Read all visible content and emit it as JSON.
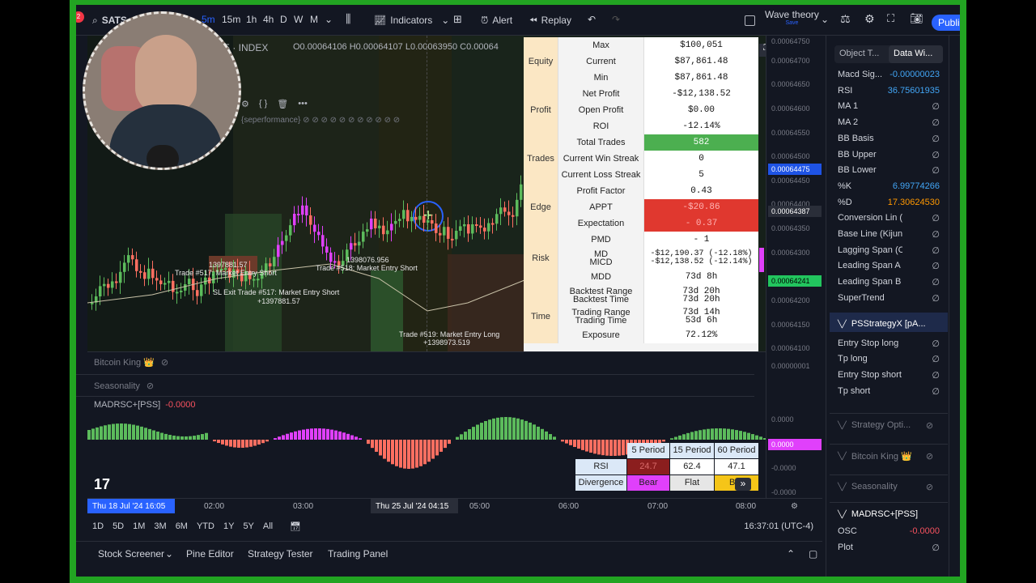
{
  "toolbar": {
    "symbol": "SATS",
    "timeframes": [
      "5m",
      "15m",
      "1h",
      "4h",
      "D",
      "W",
      "M"
    ],
    "indicators_label": "Indicators",
    "alert_label": "Alert",
    "replay_label": "Replay",
    "layout_name": "Wave theory",
    "layout_status": "Save",
    "publish_label": "Publis",
    "notification_count": "2"
  },
  "chart": {
    "symbol_header": "· 5 · INDEX",
    "ohlc": "O0.00064106 H0.00064107 L0.00063950 C0.00064",
    "strategy_label": "{seperformance} ⊘ ⊘ ⊘ ⊘ ⊘ ⊘ ⊘ ⊘ ⊘ ⊘ ⊘",
    "annotations": [
      "1397881.57",
      "Trade #517: Market Entry Short",
      "1398076.956",
      "Trade #518: Market Entry Short",
      "SL Exit Trade #517: Market Entry Short",
      "+1397881.57",
      "Trade #519: Market Entry Long",
      "+1398973.519"
    ]
  },
  "price_axis": {
    "labels": [
      "0.00064750",
      "0.00064700",
      "0.00064650",
      "0.00064600",
      "0.00064550",
      "0.00064500",
      "0.00064450",
      "0.00064400",
      "0.00064350",
      "0.00064300",
      "0.00064200",
      "0.00064150",
      "0.00064100",
      "0.00000001",
      "0.0000",
      "-0.0000",
      "-0.0000"
    ],
    "tag_blue": "0.00064475",
    "tag_grey": "0.00064387",
    "tag_green": "0.00064241",
    "sub_tag": "0.0000"
  },
  "performance_table": {
    "rows": [
      {
        "cat": "",
        "key": "Max",
        "val": "$100,051"
      },
      {
        "cat": "Equity",
        "key": "Current",
        "val": "$87,861.48"
      },
      {
        "cat": "",
        "key": "Min",
        "val": "$87,861.48"
      },
      {
        "cat": "",
        "key": "Net Profit",
        "val": "-$12,138.52"
      },
      {
        "cat": "Profit",
        "key": "Open Profit",
        "val": "$0.00"
      },
      {
        "cat": "",
        "key": "ROI",
        "val": "-12.14%"
      },
      {
        "cat": "",
        "key": "Total Trades",
        "val": "582"
      },
      {
        "cat": "Trades",
        "key": "Current Win Streak",
        "val": "0"
      },
      {
        "cat": "",
        "key": "Current Loss Streak",
        "val": "5"
      },
      {
        "cat": "",
        "key": "Profit Factor",
        "val": "0.43"
      },
      {
        "cat": "Edge",
        "key": "APPT",
        "val": "-$20.86"
      },
      {
        "cat": "",
        "key": "Expectation",
        "val": "- 0.37"
      },
      {
        "cat": "",
        "key": "PMD",
        "val": "- 1"
      },
      {
        "cat": "Risk",
        "key": "MD\nMICD",
        "val": "-$12,190.37 (-12.18%)\n-$12,138.52 (-12.14%)"
      },
      {
        "cat": "",
        "key": "MDD",
        "val": "73d 8h"
      },
      {
        "cat": "",
        "key": "Backtest Range\nBacktest Time",
        "val": "73d 20h\n73d 20h"
      },
      {
        "cat": "Time",
        "key": "Trading Range\nTrading Time",
        "val": "73d 14h\n53d 6h"
      },
      {
        "cat": "",
        "key": "Exposure",
        "val": "72.12%"
      }
    ]
  },
  "sub_panes": {
    "pane1": "Bitcoin King 👑",
    "pane2": "Seasonality",
    "pane3_title": "MADRSC+[PSS]",
    "pane3_value": "-0.0000"
  },
  "mini_table": {
    "headers": [
      "5 Period",
      "15 Period",
      "60 Period"
    ],
    "row1_label": "RSI",
    "row1": [
      "24.7",
      "62.4",
      "47.1"
    ],
    "row2_label": "Divergence",
    "row2": [
      "Bear",
      "Flat",
      "Bu"
    ]
  },
  "time_axis": {
    "tag_left": "Thu 18 Jul '24   16:05",
    "tag_mid": "Thu 25 Jul '24   04:15",
    "labels": [
      "02:00",
      "03:00",
      "05:00",
      "06:00",
      "07:00",
      "08:00"
    ]
  },
  "range_bar": {
    "ranges": [
      "1D",
      "5D",
      "1M",
      "3M",
      "6M",
      "YTD",
      "1Y",
      "5Y",
      "All"
    ],
    "clock": "16:37:01 (UTC-4)"
  },
  "bottom_tabs": [
    "Stock Screener",
    "Pine Editor",
    "Strategy Tester",
    "Trading Panel"
  ],
  "data_window": {
    "tabs": [
      "Object T...",
      "Data Wi..."
    ],
    "rows": [
      {
        "k": "Macd Sig...",
        "v": "-0.00000023",
        "c": "#42a5f5"
      },
      {
        "k": "RSI",
        "v": "36.75601935",
        "c": "#42a5f5"
      },
      {
        "k": "MA 1",
        "v": "∅",
        "c": "#b2b5be"
      },
      {
        "k": "MA 2",
        "v": "∅",
        "c": "#b2b5be"
      },
      {
        "k": "BB Basis",
        "v": "∅",
        "c": "#b2b5be"
      },
      {
        "k": "BB Upper",
        "v": "∅",
        "c": "#b2b5be"
      },
      {
        "k": "BB Lower",
        "v": "∅",
        "c": "#b2b5be"
      },
      {
        "k": "%K",
        "v": "6.99774266",
        "c": "#42a5f5"
      },
      {
        "k": "%D",
        "v": "17.30624530",
        "c": "#ff9800"
      },
      {
        "k": "Conversion Lin (Tenka...",
        "v": "∅",
        "c": "#b2b5be"
      },
      {
        "k": "Base Line (Kijun)",
        "v": "∅",
        "c": "#b2b5be"
      },
      {
        "k": "Lagging Span (Chikou)",
        "v": "∅",
        "c": "#b2b5be"
      },
      {
        "k": "Leading Span A (Senk...",
        "v": "∅",
        "c": "#b2b5be"
      },
      {
        "k": "Leading Span B (Senk...",
        "v": "∅",
        "c": "#b2b5be"
      },
      {
        "k": "SuperTrend",
        "v": "∅",
        "c": "#b2b5be"
      }
    ],
    "section_strategy": "PSStrategyX [pA...",
    "strategy_rows": [
      {
        "k": "Entry Stop long",
        "v": "∅"
      },
      {
        "k": "Tp long",
        "v": "∅"
      },
      {
        "k": "Entry Stop short",
        "v": "∅"
      },
      {
        "k": "Tp short",
        "v": "∅"
      }
    ],
    "hidden_sections": [
      "Strategy Opti...",
      "Bitcoin King 👑",
      "Seasonality"
    ],
    "section_madrsc": "MADRSC+[PSS]",
    "madrsc_rows": [
      {
        "k": "OSC",
        "v": "-0.0000",
        "c": "#f7525f"
      },
      {
        "k": "Plot",
        "v": "∅",
        "c": "#b2b5be"
      }
    ]
  },
  "colors": {
    "green_border": "#22a422",
    "accent_blue": "#2962ff",
    "bull": "#f06292",
    "bear_candle": "#ff6f61",
    "green_bar": "#5cbb5c",
    "magenta": "#e040fb"
  }
}
